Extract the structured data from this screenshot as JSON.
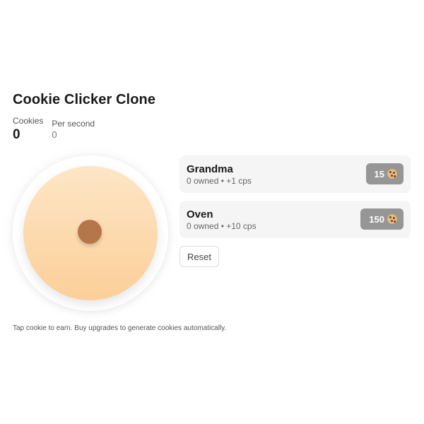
{
  "app": {
    "title": "Cookie Clicker Clone"
  },
  "stats": {
    "cookies_label": "Cookies",
    "cookies_value": "0",
    "per_second_label": "Per second",
    "per_second_value": "0"
  },
  "cookie": {
    "icon": "cookie-icon",
    "chip_icon": "chocolate-chip-icon"
  },
  "upgrades": [
    {
      "name": "Grandma",
      "detail": "0 owned • +1 cps",
      "cost": "15",
      "cost_icon": "cookie-icon"
    },
    {
      "name": "Oven",
      "detail": "0 owned • +10 cps",
      "cost": "150",
      "cost_icon": "cookie-icon"
    }
  ],
  "actions": {
    "reset_label": "Reset"
  },
  "hint": "Tap cookie to earn. Buy upgrades to generate cookies automatically.",
  "colors": {
    "cookie_top": "#fde6c7",
    "cookie_bottom": "#fccf98",
    "chip": "#b4764a",
    "buy_button": "#969696",
    "card_background": "#f5f5f5"
  }
}
